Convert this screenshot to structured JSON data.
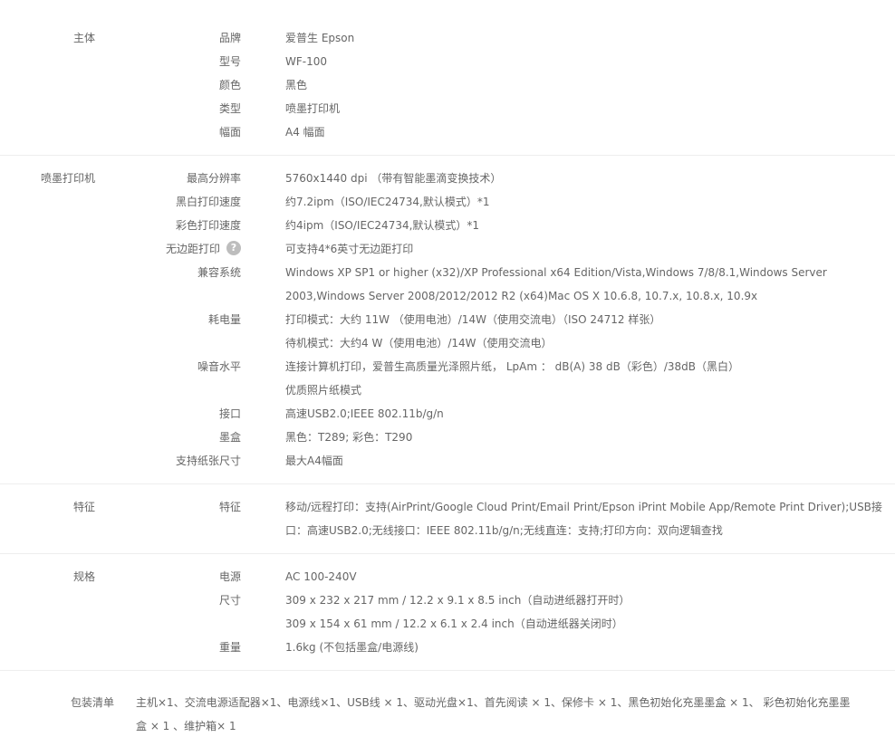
{
  "sections": [
    {
      "title": "主体",
      "rows": [
        {
          "label": "品牌",
          "value": "爱普生 Epson"
        },
        {
          "label": "型号",
          "value": "WF-100"
        },
        {
          "label": "颜色",
          "value": "黑色"
        },
        {
          "label": "类型",
          "value": "喷墨打印机"
        },
        {
          "label": "幅面",
          "value": "A4 幅面"
        }
      ]
    },
    {
      "title": "喷墨打印机",
      "rows": [
        {
          "label": "最高分辨率",
          "value": "5760x1440 dpi （带有智能墨滴变换技术）"
        },
        {
          "label": "黑白打印速度",
          "value": "约7.2ipm（ISO/IEC24734,默认模式）*1"
        },
        {
          "label": "彩色打印速度",
          "value": "约4ipm（ISO/IEC24734,默认模式）*1"
        },
        {
          "label": "无边距打印",
          "value": "可支持4*6英寸无边距打印"
        },
        {
          "label": "兼容系统",
          "value": "Windows XP SP1 or higher (x32)/XP Professional x64 Edition/Vista,Windows 7/8/8.1,Windows Server 2003,Windows Server 2008/2012/2012 R2 (x64)Mac OS X 10.6.8, 10.7.x, 10.8.x, 10.9x"
        },
        {
          "label": "耗电量",
          "value": "打印模式：大约 11W （使用电池）/14W（使用交流电）（ISO 24712 样张）"
        },
        {
          "label": "",
          "value": "待机模式：大约4 W（使用电池）/14W（使用交流电）"
        },
        {
          "label": "噪音水平",
          "value": "连接计算机打印，爱普生高质量光泽照片纸， LpAm ： dB(A) 38 dB（彩色）/38dB（黑白）"
        },
        {
          "label": "",
          "value": "优质照片纸模式"
        },
        {
          "label": "接口",
          "value": "高速USB2.0;IEEE 802.11b/g/n"
        },
        {
          "label": "墨盒",
          "value": "黑色：T289; 彩色：T290"
        },
        {
          "label": "支持纸张尺寸",
          "value": "最大A4幅面"
        }
      ]
    },
    {
      "title": "特征",
      "rows": [
        {
          "label": "特征",
          "value": "移动/远程打印：支持(AirPrint/Google Cloud Print/Email Print/Epson iPrint Mobile App/Remote Print Driver);USB接口：高速USB2.0;无线接口：IEEE 802.11b/g/n;无线直连：支持;打印方向：双向逻辑查找"
        }
      ]
    },
    {
      "title": "规格",
      "rows": [
        {
          "label": "电源",
          "value": "AC 100-240V"
        },
        {
          "label": "尺寸",
          "value": "309 x 232 x 217 mm / 12.2 x 9.1 x 8.5 inch（自动进纸器打开时）"
        },
        {
          "label": "",
          "value": "309 x 154 x 61 mm / 12.2 x 6.1 x 2.4 inch（自动进纸器关闭时）"
        },
        {
          "label": "重量",
          "value": "1.6kg (不包括墨盒/电源线)"
        }
      ]
    }
  ],
  "package": {
    "title": "包装清单",
    "value": "主机×1、交流电源适配器×1、电源线×1、USB线 × 1、驱动光盘×1、首先阅读 × 1、保修卡 × 1、黑色初始化充墨墨盒 × 1、 彩色初始化充墨墨盒 × 1 、维护箱× 1"
  },
  "help_icon": {
    "name": "question-icon",
    "glyph": "?",
    "color": "#bdbdbd"
  }
}
